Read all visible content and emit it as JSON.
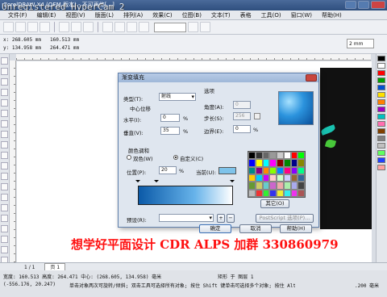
{
  "app": {
    "title": "CorelDRAW X4 (OEM 版本) - 不可再修[...]",
    "watermark_top": "Unregistered HyperCam 2"
  },
  "menu": [
    "文件(F)",
    "编辑(E)",
    "视图(V)",
    "版面(L)",
    "排列(A)",
    "效果(C)",
    "位图(B)",
    "文本(T)",
    "表格",
    "工具(O)",
    "窗口(W)",
    "帮助(H)"
  ],
  "propbar": {
    "x": "x: 268.605 mm",
    "y": "y: 134.958 mm",
    "w": "160.513 mm",
    "h": "264.471 mm",
    "unit": "2 mm"
  },
  "dialog": {
    "title": "渐变填充",
    "type_label": "类型(T):",
    "type_value": "射线",
    "options_label": "选项",
    "angle_label": "角度(A):",
    "angle_value": "0",
    "steps_label": "步长(S):",
    "steps_value": "256",
    "edge_pad_label": "边界(E):",
    "edge_pad_value": "0",
    "center_label": "中心位移",
    "horiz_label": "水平(I):",
    "horiz_value": "0",
    "vert_label": "垂直(V):",
    "vert_value": "35",
    "pct": "%",
    "color_blend_label": "颜色调和",
    "two_color_label": "双色(W)",
    "custom_label": "自定义(C)",
    "position_label": "位置(P):",
    "position_value": "20",
    "current_label": "当前(U):",
    "presets_label": "预设(R):",
    "others_button": "其它(O)",
    "postscript_button": "PostScript 选项(P)...",
    "ok": "确定",
    "cancel": "取消",
    "help": "帮助(H)"
  },
  "pagebar": {
    "counter": "1 / 1",
    "page_tab": "页 1"
  },
  "status": {
    "line1": "宽度: 160.513  高度: 264.471  中心: (268.605, 134.958)  毫米",
    "line1_right": "矩形 于 图层 1",
    "line2": "(-556.176, 20.247)",
    "line2_text": "单击对象两次可旋转/倾斜; 双击工具可选择所有对象; 按住 Shift 键单击可选择多个对象; 按住 Alt 键...",
    "line2_right": ".200 毫米"
  },
  "promo": "想学好平面设计  CDR ALPS 加群  330860979",
  "colors": {
    "accent": "#2b93dd",
    "promo": "#ff1010",
    "palette": [
      "#000000",
      "#ffffff",
      "#ff0000",
      "#00a000",
      "#0050d0",
      "#ffe000",
      "#ff8000",
      "#a000c0",
      "#00c0c0",
      "#ff70b0",
      "#804000",
      "#808080",
      "#c0c0c0",
      "#60ff60",
      "#2040ff",
      "#ffa0a0"
    ],
    "dialog_palette": [
      "#000",
      "#333",
      "#666",
      "#999",
      "#ccc",
      "#fff",
      "#f00",
      "#0f0",
      "#00f",
      "#ff0",
      "#0ff",
      "#f0f",
      "#800",
      "#080",
      "#008",
      "#880",
      "#088",
      "#808",
      "#f80",
      "#8f0",
      "#08f",
      "#f08",
      "#80f",
      "#0f8",
      "#fc0",
      "#0cf",
      "#c0f",
      "#fcc",
      "#cfc",
      "#ccf",
      "#963",
      "#369",
      "#693",
      "#cc6",
      "#6cc",
      "#c6c",
      "#eaa",
      "#aea",
      "#aae",
      "#444",
      "#bbb",
      "#e33",
      "#3e3",
      "#33e",
      "#ee3",
      "#3ee",
      "#e3e",
      "#a55"
    ]
  }
}
